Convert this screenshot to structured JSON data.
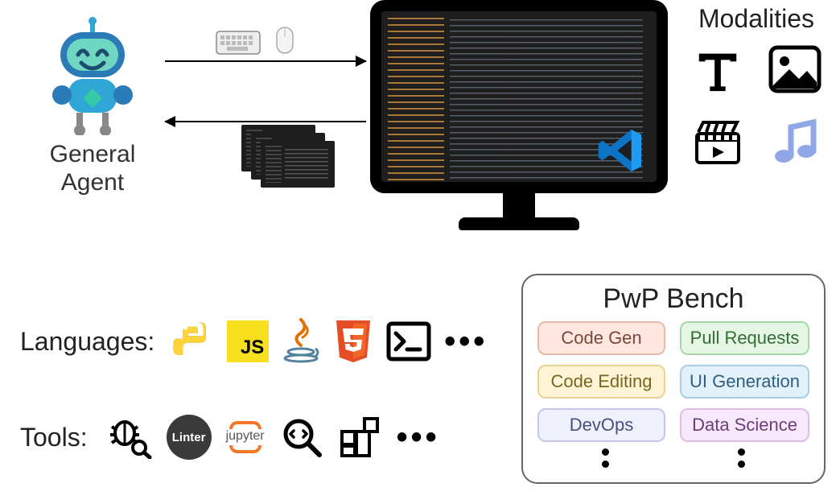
{
  "agent": {
    "label_line1": "General",
    "label_line2": "Agent"
  },
  "modalities": {
    "title": "Modalities",
    "items": [
      "text-icon",
      "image-icon",
      "video-icon",
      "audio-icon"
    ]
  },
  "languages": {
    "label": "Languages:",
    "items": [
      "python",
      "javascript",
      "java",
      "html5",
      "terminal"
    ],
    "js_text": "JS"
  },
  "tools": {
    "label": "Tools:",
    "items": [
      "debugger",
      "linter",
      "jupyter",
      "code-search",
      "extensions"
    ],
    "linter_text": "Linter",
    "jupyter_text": "jupyter"
  },
  "bench": {
    "title": "PwP Bench",
    "chips": [
      {
        "key": "codegen",
        "label": "Code Gen"
      },
      {
        "key": "pr",
        "label": "Pull Requests"
      },
      {
        "key": "edit",
        "label": "Code Editing"
      },
      {
        "key": "ui",
        "label": "UI Generation"
      },
      {
        "key": "devops",
        "label": "DevOps"
      },
      {
        "key": "ds",
        "label": "Data Science"
      }
    ]
  },
  "peripherals": {
    "keyboard": "keyboard-icon",
    "mouse": "mouse-icon"
  },
  "editor": {
    "name": "vscode"
  }
}
